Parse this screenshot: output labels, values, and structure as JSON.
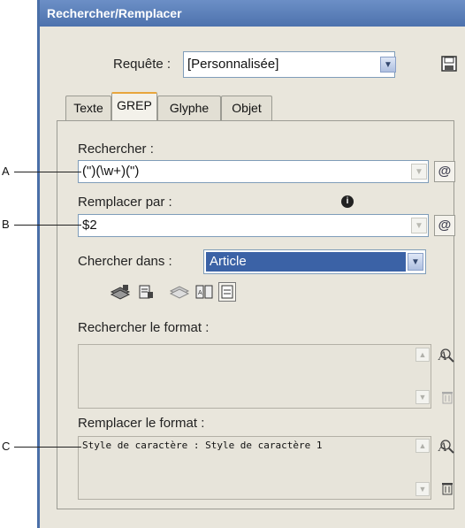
{
  "window": {
    "title": "Rechercher/Remplacer"
  },
  "query": {
    "label": "Requête :",
    "value": "[Personnalisée]"
  },
  "tabs": [
    "Texte",
    "GREP",
    "Glyphe",
    "Objet"
  ],
  "find": {
    "label": "Rechercher :",
    "value": "(\")(\\w+)(\")",
    "special_button": "@"
  },
  "replace": {
    "label": "Remplacer par :",
    "value": "$2",
    "special_button": "@",
    "info_icon": "i"
  },
  "search_in": {
    "label": "Chercher dans :",
    "value": "Article"
  },
  "find_format": {
    "label": "Rechercher le format :",
    "value": ""
  },
  "replace_format": {
    "label": "Remplacer le format :",
    "value": "Style de caractère : Style de caractère 1"
  },
  "callouts": [
    "A",
    "B",
    "C"
  ],
  "icons": [
    "save-query-icon",
    "dropdown-arrow-icon",
    "special-characters-icon",
    "info-icon",
    "locked-layers-icon",
    "locked-stories-icon",
    "hidden-layers-icon",
    "master-pages-icon",
    "footnotes-icon",
    "specify-format-icon",
    "clear-format-icon"
  ],
  "colors": {
    "title_bar": "#5d80b6",
    "selection": "#3b62a6",
    "active_tab_accent": "#e8a63c"
  }
}
